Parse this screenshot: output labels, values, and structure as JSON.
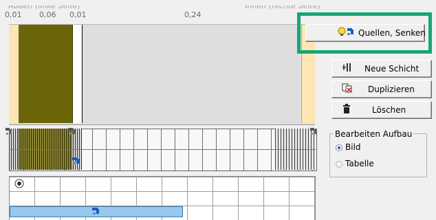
{
  "header": {
    "outside_label": "Außen (linke Seite)",
    "inside_label": "Innen (rechte Seite)"
  },
  "scale": {
    "tick_1": "0,01",
    "tick_2": "0,06",
    "tick_3": "0,01",
    "tick_4": "0,24"
  },
  "buttons": {
    "sources_sinks": "Quellen, Senken",
    "new_layer": "Neue Schicht",
    "duplicate": "Duplizieren",
    "delete": "Löschen"
  },
  "edit_layout": {
    "title": "Bearbeiten Aufbau",
    "option_image": "Bild",
    "option_table": "Tabelle",
    "selected": "Bild"
  },
  "icons": {
    "sources_sinks": "lightbulb-tap-icon",
    "new_layer": "insert-layer-icon",
    "duplicate": "duplicate-icon",
    "delete": "trash-icon",
    "mesh_handle": "tap-icon",
    "grid_marker": "target-icon"
  },
  "colors": {
    "highlight": "#16a672",
    "layer_olive": "#6b650a",
    "surface_strip": "#fde6b4",
    "grid_bar": "#99c8ee"
  }
}
